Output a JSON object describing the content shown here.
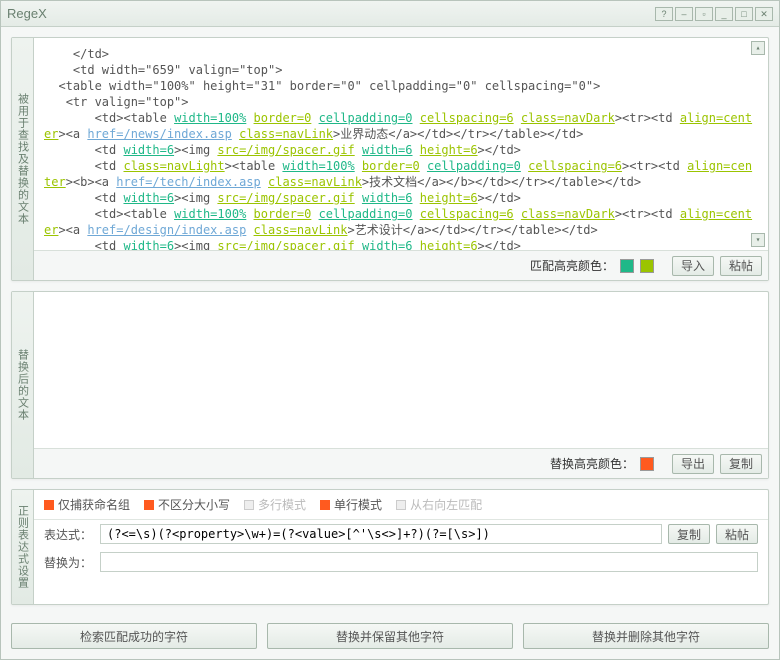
{
  "window": {
    "title": "RegeX"
  },
  "panel1": {
    "label": "被用于查找及替换的文本",
    "text_segments": [
      {
        "t": "    </td>\n    <td width=\"659\" valign=\"top\">\n  <table width=\"100%\" height=\"31\" border=\"0\" cellpadding=\"0\" cellspacing=\"0\">\n   <tr valign=\"top\">\n       <td><table ",
        "c": ""
      },
      {
        "t": "width=100%",
        "c": "c1 attr"
      },
      {
        "t": " ",
        "c": ""
      },
      {
        "t": "border=0",
        "c": "c2 attr"
      },
      {
        "t": " ",
        "c": ""
      },
      {
        "t": "cellpadding=0",
        "c": "c1 attr"
      },
      {
        "t": " ",
        "c": ""
      },
      {
        "t": "cellspacing=6",
        "c": "c2 attr"
      },
      {
        "t": " ",
        "c": ""
      },
      {
        "t": "class=navDark",
        "c": "c2 attr"
      },
      {
        "t": "><tr><td ",
        "c": ""
      },
      {
        "t": "align=center",
        "c": "c2 attr"
      },
      {
        "t": "><a ",
        "c": ""
      },
      {
        "t": "href=/news/index.asp",
        "c": "c3 attr"
      },
      {
        "t": " ",
        "c": ""
      },
      {
        "t": "class=navLink",
        "c": "c2 attr"
      },
      {
        "t": ">业界动态</a></td></tr></table></td>\n       <td ",
        "c": ""
      },
      {
        "t": "width=6",
        "c": "c1 attr"
      },
      {
        "t": "><img ",
        "c": ""
      },
      {
        "t": "src=/img/spacer.gif",
        "c": "c2 attr"
      },
      {
        "t": " ",
        "c": ""
      },
      {
        "t": "width=6",
        "c": "c1 attr"
      },
      {
        "t": " ",
        "c": ""
      },
      {
        "t": "height=6",
        "c": "c2 attr"
      },
      {
        "t": "></td>\n       <td ",
        "c": ""
      },
      {
        "t": "class=navLight",
        "c": "c2 attr"
      },
      {
        "t": "><table ",
        "c": ""
      },
      {
        "t": "width=100%",
        "c": "c1 attr"
      },
      {
        "t": " ",
        "c": ""
      },
      {
        "t": "border=0",
        "c": "c2 attr"
      },
      {
        "t": " ",
        "c": ""
      },
      {
        "t": "cellpadding=0",
        "c": "c1 attr"
      },
      {
        "t": " ",
        "c": ""
      },
      {
        "t": "cellspacing=6",
        "c": "c2 attr"
      },
      {
        "t": "><tr><td ",
        "c": ""
      },
      {
        "t": "align=center",
        "c": "c2 attr"
      },
      {
        "t": "><b><a ",
        "c": ""
      },
      {
        "t": "href=/tech/index.asp",
        "c": "c3 attr"
      },
      {
        "t": " ",
        "c": ""
      },
      {
        "t": "class=navLink",
        "c": "c2 attr"
      },
      {
        "t": ">技术文档</a></b></td></tr></table></td>\n       <td ",
        "c": ""
      },
      {
        "t": "width=6",
        "c": "c1 attr"
      },
      {
        "t": "><img ",
        "c": ""
      },
      {
        "t": "src=/img/spacer.gif",
        "c": "c2 attr"
      },
      {
        "t": " ",
        "c": ""
      },
      {
        "t": "width=6",
        "c": "c1 attr"
      },
      {
        "t": " ",
        "c": ""
      },
      {
        "t": "height=6",
        "c": "c2 attr"
      },
      {
        "t": "></td>\n       <td><table ",
        "c": ""
      },
      {
        "t": "width=100%",
        "c": "c1 attr"
      },
      {
        "t": " ",
        "c": ""
      },
      {
        "t": "border=0",
        "c": "c2 attr"
      },
      {
        "t": " ",
        "c": ""
      },
      {
        "t": "cellpadding=0",
        "c": "c1 attr"
      },
      {
        "t": " ",
        "c": ""
      },
      {
        "t": "cellspacing=6",
        "c": "c2 attr"
      },
      {
        "t": " ",
        "c": ""
      },
      {
        "t": "class=navDark",
        "c": "c2 attr"
      },
      {
        "t": "><tr><td ",
        "c": ""
      },
      {
        "t": "align=center",
        "c": "c2 attr"
      },
      {
        "t": "><a ",
        "c": ""
      },
      {
        "t": "href=/design/index.asp",
        "c": "c3 attr"
      },
      {
        "t": " ",
        "c": ""
      },
      {
        "t": "class=navLink",
        "c": "c2 attr"
      },
      {
        "t": ">艺术设计</a></td></tr></table></td>\n       <td ",
        "c": ""
      },
      {
        "t": "width=6",
        "c": "c1 attr"
      },
      {
        "t": "><img ",
        "c": ""
      },
      {
        "t": "src=/img/spacer.gif",
        "c": "c2 attr"
      },
      {
        "t": " ",
        "c": ""
      },
      {
        "t": "width=6",
        "c": "c1 attr"
      },
      {
        "t": " ",
        "c": ""
      },
      {
        "t": "height=6",
        "c": "c2 attr"
      },
      {
        "t": "></td>",
        "c": ""
      }
    ],
    "highlight_label": "匹配高亮颜色：",
    "swatch1": "#1fb888",
    "swatch2": "#9bc400",
    "btn_import": "导入",
    "btn_paste": "粘帖"
  },
  "panel2": {
    "label": "替换后的文本",
    "text": "",
    "highlight_label": "替换高亮颜色：",
    "swatch1": "#ff5a1f",
    "btn_export": "导出",
    "btn_copy": "复制"
  },
  "panel3": {
    "label": "正则表达式设置",
    "options": [
      {
        "label": "仅捕获命名组",
        "checked": true,
        "disabled": false
      },
      {
        "label": "不区分大小写",
        "checked": true,
        "disabled": false
      },
      {
        "label": "多行模式",
        "checked": false,
        "disabled": true
      },
      {
        "label": "单行模式",
        "checked": true,
        "disabled": false
      },
      {
        "label": "从右向左匹配",
        "checked": false,
        "disabled": true
      }
    ],
    "expr_label": "表达式：",
    "expr_value": "(?<=\\s)(?<property>\\w+)=(?<value>[^'\\s<>]+?)(?=[\\s>])",
    "repl_label": "替换为：",
    "repl_value": "",
    "btn_copy": "复制",
    "btn_paste": "粘帖"
  },
  "bottom": {
    "btn_search": "检索匹配成功的字符",
    "btn_replace_keep": "替换并保留其他字符",
    "btn_replace_del": "替换并删除其他字符"
  }
}
